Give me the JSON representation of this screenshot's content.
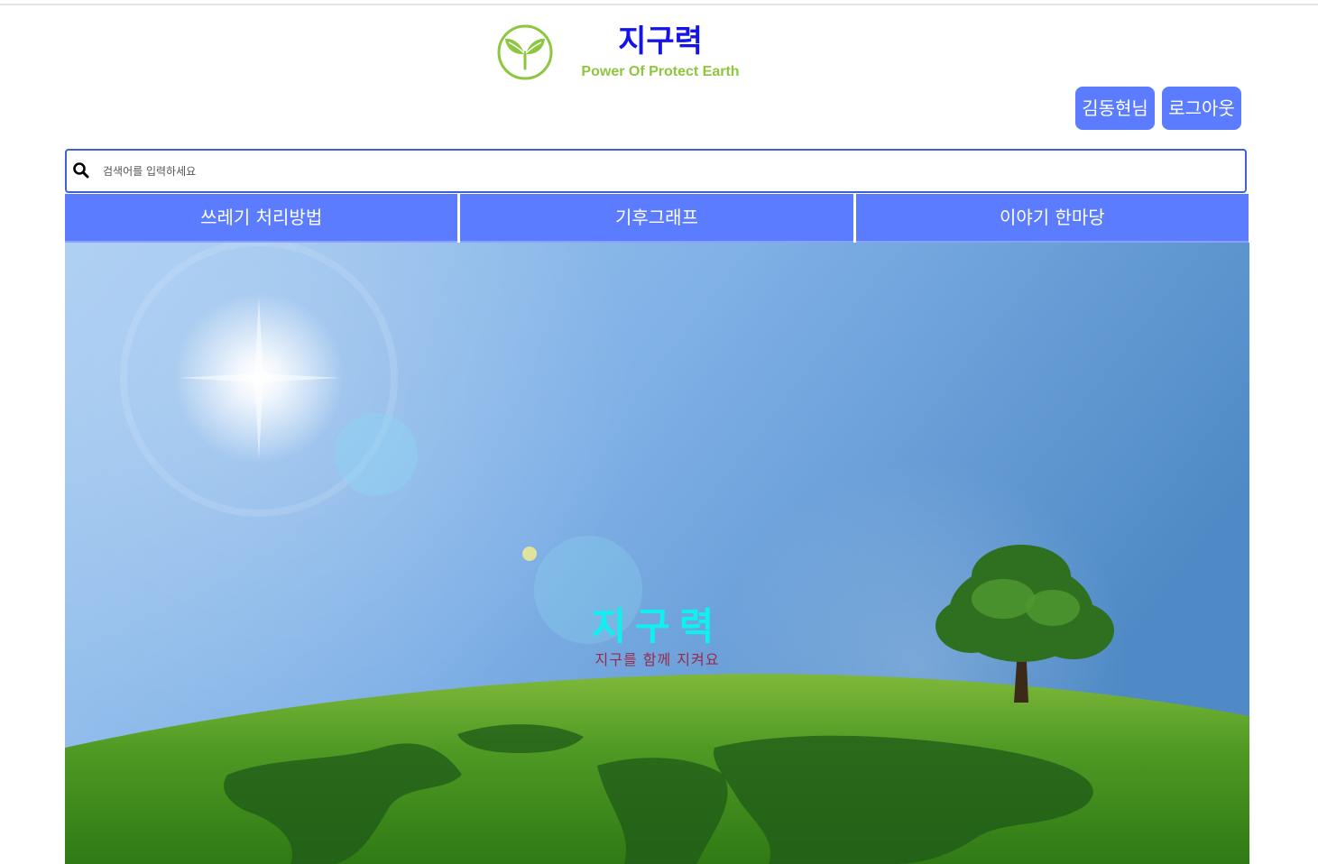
{
  "header": {
    "title": "지구력",
    "subtitle": "Power Of Protect Earth",
    "logo_icon": "sprout-leaf-icon",
    "colors": {
      "title": "#1414e6",
      "subtitle": "#8dc63f",
      "button": "#5b7cff"
    }
  },
  "user": {
    "name_label": "김동현님",
    "logout_label": "로그아웃"
  },
  "search": {
    "placeholder": "검색어를 입력하세요",
    "icon": "search-icon"
  },
  "nav": {
    "items": [
      {
        "label": "쓰레기 처리방법"
      },
      {
        "label": "기후그래프"
      },
      {
        "label": "이야기 한마당"
      }
    ]
  },
  "hero": {
    "title": "지구력",
    "subtitle": "지구를 함께 지켜요"
  }
}
